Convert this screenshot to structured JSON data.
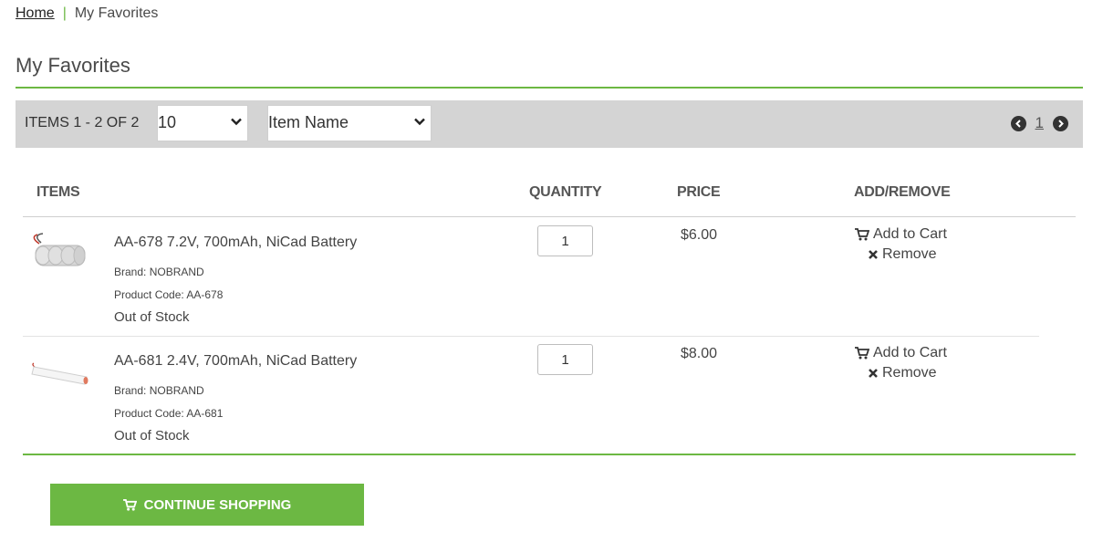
{
  "breadcrumb": {
    "home": "Home",
    "separator": "|",
    "current": "My Favorites"
  },
  "page": {
    "title": "My Favorites"
  },
  "toolbar": {
    "count_label": "ITEMS 1 - 2 OF 2",
    "per_page": "10",
    "sort_by": "Item Name",
    "current_page": "1"
  },
  "table": {
    "headers": {
      "items": "ITEMS",
      "quantity": "QUANTITY",
      "price": "PRICE",
      "actions": "ADD/REMOVE"
    },
    "rows": [
      {
        "name": "AA-678 7.2V, 700mAh, NiCad Battery",
        "brand": "Brand: NOBRAND",
        "code": "Product Code: AA-678",
        "stock": "Out of Stock",
        "quantity": "1",
        "price": "$6.00",
        "add_label": "Add to Cart",
        "remove_label": "Remove"
      },
      {
        "name": "AA-681 2.4V, 700mAh, NiCad Battery",
        "brand": "Brand: NOBRAND",
        "code": "Product Code: AA-681",
        "stock": "Out of Stock",
        "quantity": "1",
        "price": "$8.00",
        "add_label": "Add to Cart",
        "remove_label": "Remove"
      }
    ]
  },
  "footer": {
    "continue_label": "CONTINUE SHOPPING"
  },
  "colors": {
    "accent": "#6cb843",
    "toolbar_bg": "#d4d4d4"
  },
  "icons": {
    "cart": "cart-icon",
    "remove": "x-icon",
    "prev": "chevron-left-circle-icon",
    "next": "chevron-right-circle-icon",
    "dropdown": "chevron-down-icon"
  }
}
